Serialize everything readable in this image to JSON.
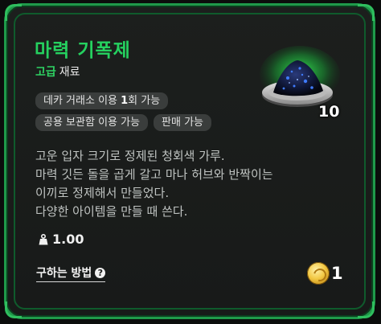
{
  "item": {
    "name": "마력 기폭제",
    "grade": "고급",
    "category": "재료",
    "quantity": "10"
  },
  "tags": {
    "row1": [
      {
        "pre": "데카 거래소 이용 ",
        "bold": "1",
        "post": "회 가능"
      }
    ],
    "row2": [
      "공용 보관함 이용 가능",
      "판매 가능"
    ]
  },
  "description": [
    "고운 입자 크기로 정제된 청회색 가루.",
    "마력 깃든 돌을 곱게 갈고 마나 허브와 반짝이는",
    "이끼로 정제해서 만들었다.",
    "다양한 아이템을 만들 때 쓴다."
  ],
  "weight": "1.00",
  "how_to_obtain_label": "구하는 방법",
  "price": "1",
  "colors": {
    "accent_green": "#25d15f",
    "frame_green": "#1f9a4a"
  },
  "icons": [
    "weight-icon",
    "help-icon",
    "gold-coin-icon"
  ]
}
